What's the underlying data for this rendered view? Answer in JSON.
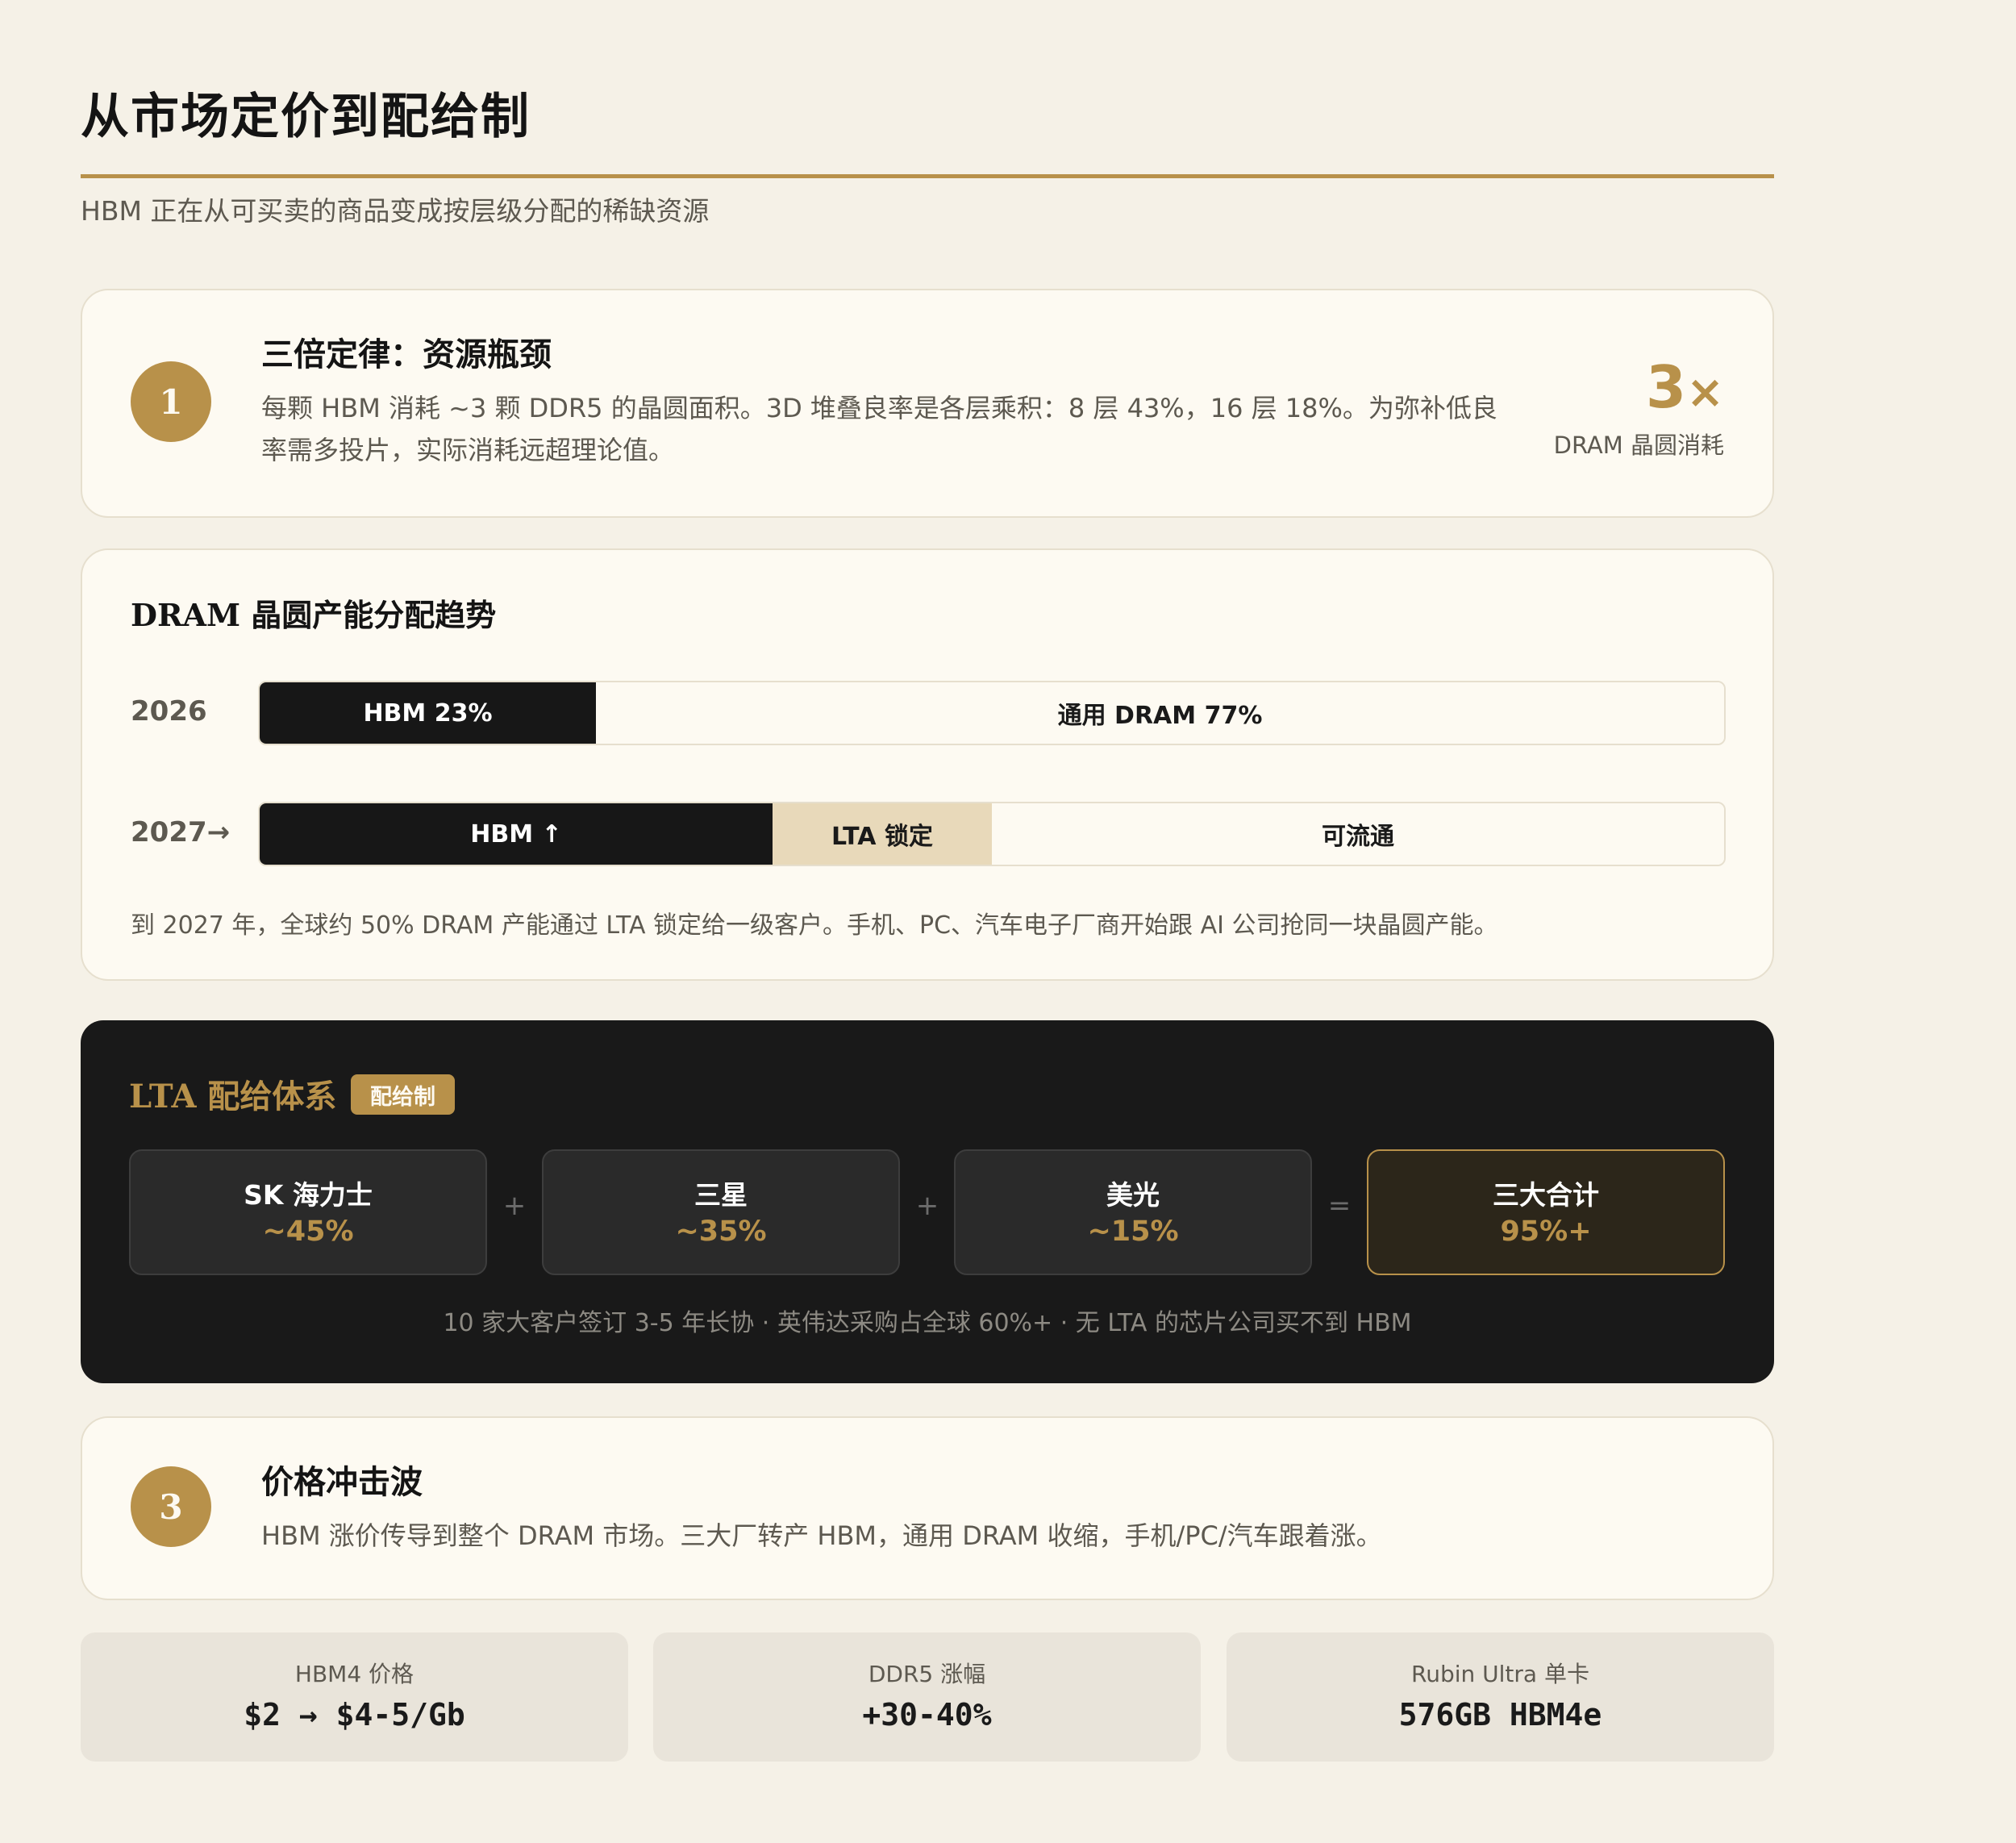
{
  "header": {
    "title": "从市场定价到配给制",
    "subtitle": "HBM 正在从可买卖的商品变成按层级分配的稀缺资源"
  },
  "card1": {
    "number": "1",
    "heading": "三倍定律：资源瓶颈",
    "body_line1": "每颗 HBM 消耗 ~3 颗 DDR5 的晶圆面积。3D 堆叠良率是各层乘积：8 层 43%，16 层 18%。为弥补低良",
    "body_line2": "率需多投片，实际消耗远超理论值。",
    "stat_value": "3",
    "stat_suffix": "×",
    "stat_label": "DRAM 晶圆消耗"
  },
  "allocation": {
    "title": "DRAM 晶圆产能分配趋势",
    "rows": [
      {
        "year": "2026",
        "segments": [
          {
            "label": "HBM 23%",
            "share": 0.23,
            "style": "dark"
          },
          {
            "label": "通用 DRAM 77%",
            "share": 0.77,
            "style": "light"
          }
        ]
      },
      {
        "year": "2027→",
        "segments": [
          {
            "label": "HBM ↑",
            "share": 0.35,
            "style": "dark"
          },
          {
            "label": "LTA 锁定",
            "share": 0.15,
            "style": "tan"
          },
          {
            "label": "可流通",
            "share": 0.5,
            "style": "light"
          }
        ]
      }
    ],
    "note": "到 2027 年，全球约 50% DRAM 产能通过 LTA 锁定给一级客户。手机、PC、汽车电子厂商开始跟 AI 公司抢同一块晶圆产能。"
  },
  "lta": {
    "title": "LTA 配给体系",
    "tag": "配给制",
    "suppliers": [
      {
        "name": "SK 海力士",
        "share": "~45%"
      },
      {
        "name": "三星",
        "share": "~35%"
      },
      {
        "name": "美光",
        "share": "~15%"
      }
    ],
    "total": {
      "name": "三大合计",
      "share": "95%+"
    },
    "op_plus": "+",
    "op_equals": "=",
    "note": "10 家大客户签订 3-5 年长协 · 英伟达采购占全球 60%+ · 无 LTA 的芯片公司买不到 HBM"
  },
  "card3": {
    "number": "3",
    "heading": "价格冲击波",
    "body": "HBM 涨价传导到整个 DRAM 市场。三大厂转产 HBM，通用 DRAM 收缩，手机/PC/汽车跟着涨。"
  },
  "stats": [
    {
      "label": "HBM4 价格",
      "value": "$2 → $4-5/Gb"
    },
    {
      "label": "DDR5 涨幅",
      "value": "+30-40%"
    },
    {
      "label": "Rubin Ultra 单卡",
      "value": "576GB HBM4e"
    }
  ],
  "colors": {
    "accent": "#b8914a",
    "background": "#f5f1e7",
    "card": "#fdfaf2",
    "dark_panel": "#191919",
    "tan": "#e8d9ba"
  }
}
